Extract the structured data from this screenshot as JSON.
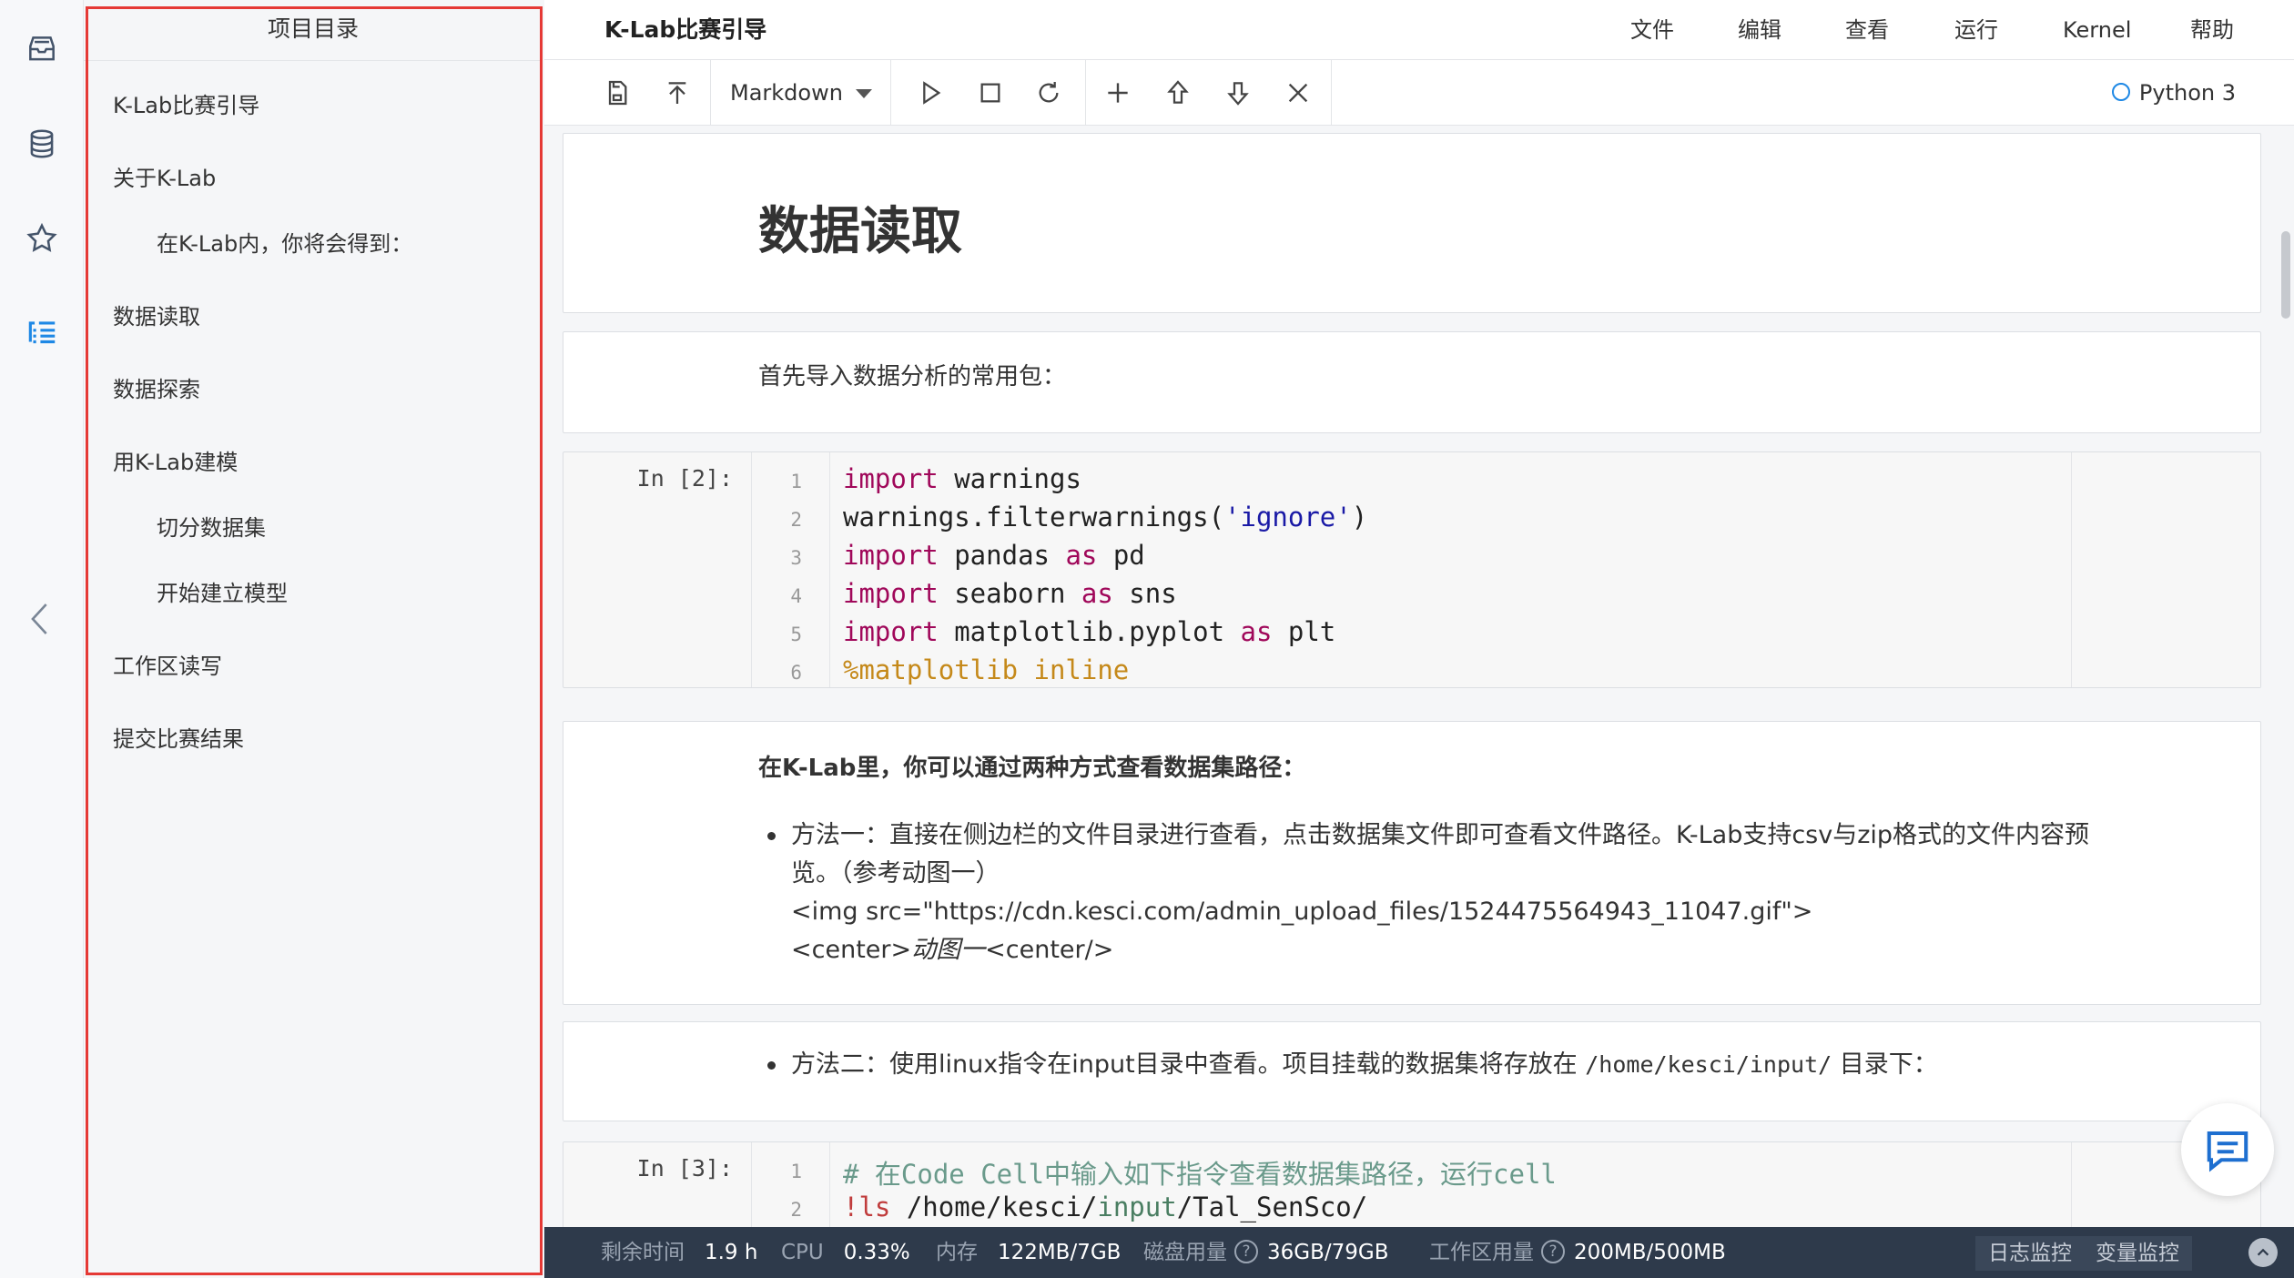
{
  "sidebar_rail": {
    "icons": [
      "inbox-icon",
      "database-icon",
      "star-icon",
      "toc-list-icon"
    ],
    "collapse_icon": "chevron-left-icon"
  },
  "toc": {
    "title": "项目目录",
    "items": [
      {
        "label": "K-Lab比赛引导",
        "level": 1
      },
      {
        "label": "关于K-Lab",
        "level": 1
      },
      {
        "label": "在K-Lab内，你将会得到：",
        "level": 2
      },
      {
        "label": "数据读取",
        "level": 1
      },
      {
        "label": "数据探索",
        "level": 1
      },
      {
        "label": "用K-Lab建模",
        "level": 1
      },
      {
        "label": "切分数据集",
        "level": 2
      },
      {
        "label": "开始建立模型",
        "level": 2
      },
      {
        "label": "工作区读写",
        "level": 1
      },
      {
        "label": "提交比赛结果",
        "level": 1
      }
    ]
  },
  "header": {
    "doc_title": "K-Lab比赛引导",
    "menus": [
      "文件",
      "编辑",
      "查看",
      "运行",
      "Kernel",
      "帮助"
    ]
  },
  "toolbar": {
    "cell_type": "Markdown",
    "kernel_name": "Python 3",
    "icons": [
      "save-icon",
      "move-top-icon",
      "run-icon",
      "stop-icon",
      "restart-icon",
      "add-cell-icon",
      "move-up-icon",
      "move-down-icon",
      "delete-cell-icon"
    ]
  },
  "cells": {
    "heading": "数据读取",
    "intro": "首先导入数据分析的常用包：",
    "code1": {
      "prompt": "In [2]:",
      "line_numbers": [
        "1",
        "2",
        "3",
        "4",
        "5",
        "6"
      ],
      "l1_kw": "import",
      "l1_rest": " warnings",
      "l2_pre": "warnings.filterwarnings(",
      "l2_str": "'ignore'",
      "l2_post": ")",
      "l3_kw": "import",
      "l3_mid": " pandas ",
      "l3_as": "as",
      "l3_rest": " pd",
      "l4_kw": "import",
      "l4_mid": " seaborn ",
      "l4_as": "as",
      "l4_rest": " sns",
      "l5_kw": "import",
      "l5_mid": " matplotlib.pyplot ",
      "l5_as": "as",
      "l5_rest": " plt",
      "l6_magic": "%matplotlib inline"
    },
    "md2": {
      "heading": "在K-Lab里，你可以通过两种方式查看数据集路径：",
      "bullet_line1": "方法一：直接在侧边栏的文件目录进行查看，点击数据集文件即可查看文件路径。K-Lab支持csv与zip格式的文件内容预",
      "bullet_line2": "览。（参考动图一）",
      "bullet_line3": "<img src=\"https://cdn.kesci.com/admin_upload_files/1524475564943_11047.gif\">",
      "bullet_line4_pre": "<center>",
      "bullet_line4_ital": "动图一",
      "bullet_line4_post": "<center/>"
    },
    "md3": {
      "bullet_pre": "方法二：使用linux指令在input目录中查看。项目挂载的数据集将存放在 ",
      "bullet_code": "/home/kesci/input/",
      "bullet_post": " 目录下："
    },
    "code2": {
      "prompt": "In [3]:",
      "line_numbers": [
        "1",
        "2"
      ],
      "l1_comment": "# 在Code Cell中输入如下指令查看数据集路径，运行cell",
      "l2_bang": "!ls",
      "l2_a": " /home/kesci/",
      "l2_b": "input",
      "l2_c": "/Tal_SenSco/"
    }
  },
  "statusbar": {
    "time_label": "剩余时间",
    "time_value": "1.9 h",
    "cpu_label": "CPU",
    "cpu_value": "0.33%",
    "mem_label": "内存",
    "mem_value": "122MB/7GB",
    "disk_label": "磁盘用量",
    "disk_value": "36GB/79GB",
    "workspace_label": "工作区用量",
    "workspace_value": "200MB/500MB",
    "log_monitor": "日志监控",
    "var_monitor": "变量监控"
  },
  "colors": {
    "accent": "#1e88e5",
    "toc_highlight": "#e53935",
    "statusbar_bg": "#2e3a4b",
    "keyword": "#a0085a",
    "string": "#1a1aa6",
    "magic": "#c5891a"
  }
}
